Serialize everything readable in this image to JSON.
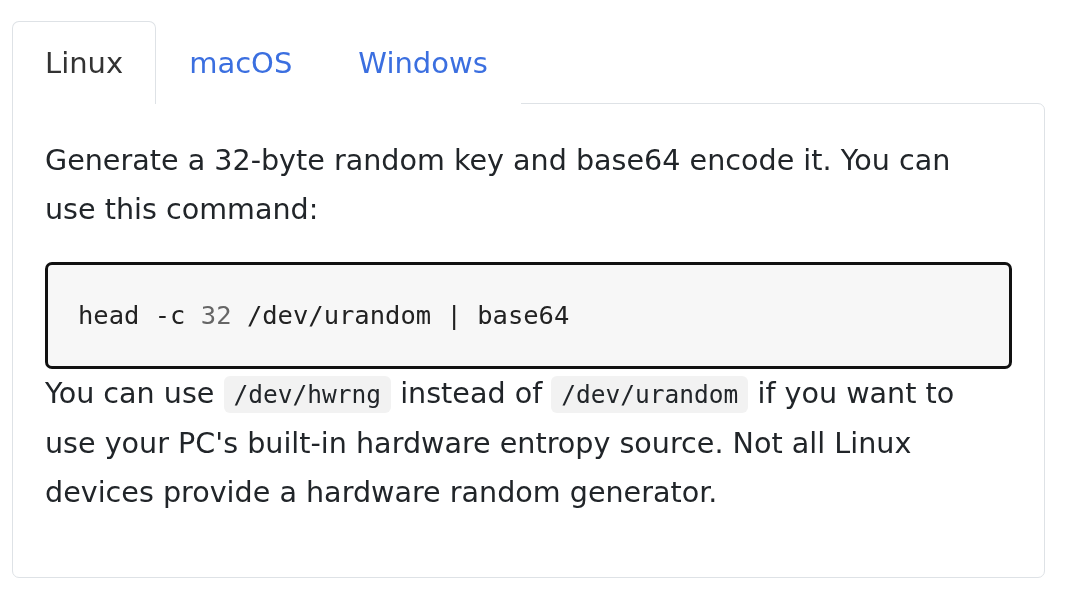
{
  "tabs": [
    {
      "label": "Linux",
      "selected": true
    },
    {
      "label": "macOS",
      "selected": false
    },
    {
      "label": "Windows",
      "selected": false
    }
  ],
  "panel": {
    "intro": "Generate a 32-byte random key and base64 encode it. You can use this command:",
    "code_block": {
      "tokens": [
        {
          "kind": "plain",
          "text": "head -c "
        },
        {
          "kind": "number",
          "text": "32"
        },
        {
          "kind": "plain",
          "text": " /dev/urandom | base64"
        }
      ]
    },
    "note": [
      {
        "kind": "text",
        "text": "You can use "
      },
      {
        "kind": "code",
        "text": "/dev/hwrng"
      },
      {
        "kind": "text",
        "text": " instead of "
      },
      {
        "kind": "code",
        "text": "/dev/urandom"
      },
      {
        "kind": "text",
        "text": " if you want to use your PC's built-in hardware entropy source. Not all Linux devices provide a hardware random generator."
      }
    ]
  }
}
